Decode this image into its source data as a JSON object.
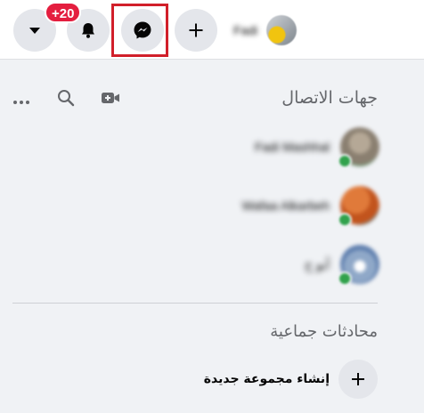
{
  "header": {
    "notification_badge": "+20",
    "profile_name": "Fadi",
    "highlighted_button": "messenger-button"
  },
  "icons": {
    "account": "chevron-down-icon",
    "notifications": "bell-icon",
    "messenger": "messenger-icon",
    "create": "plus-icon",
    "video": "video-camera-icon",
    "search": "search-icon",
    "more": "more-horizontal-icon"
  },
  "contacts": {
    "title": "جهات الاتصال",
    "items": [
      {
        "name": "Fadi Mashhal",
        "online": true
      },
      {
        "name": "Wafaa Alkarbeh",
        "online": true
      },
      {
        "name": "أبو ح",
        "online": true
      }
    ]
  },
  "groups": {
    "title": "محادثات جماعية",
    "create_label": "إنشاء مجموعة جديدة"
  },
  "colors": {
    "badge": "#e41e3f",
    "highlight": "#d11f2a",
    "online": "#31a24c"
  }
}
